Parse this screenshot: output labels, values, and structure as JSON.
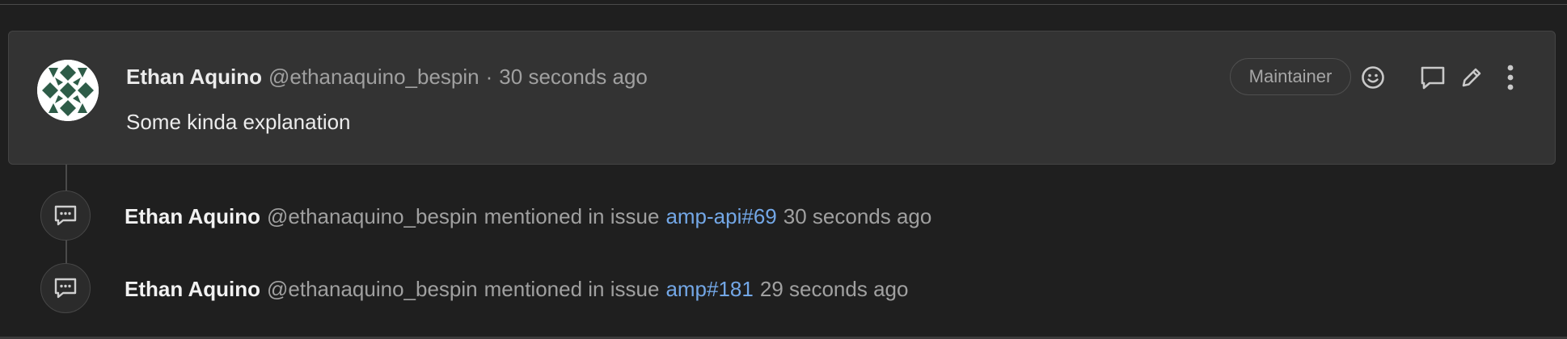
{
  "note": {
    "author_name": "Ethan Aquino",
    "author_handle": "@ethanaquino_bespin",
    "separator": "·",
    "timestamp": "30 seconds ago",
    "body": "Some kinda explanation",
    "role_badge": "Maintainer",
    "actions": [
      "add-reaction",
      "reply",
      "edit",
      "more-actions"
    ]
  },
  "system_notes": [
    {
      "author_name": "Ethan Aquino",
      "author_handle": "@ethanaquino_bespin",
      "action": "mentioned in issue",
      "reference": "amp-api#69",
      "timestamp": "30 seconds ago"
    },
    {
      "author_name": "Ethan Aquino",
      "author_handle": "@ethanaquino_bespin",
      "action": "mentioned in issue",
      "reference": "amp#181",
      "timestamp": "29 seconds ago"
    }
  ],
  "colors": {
    "background": "#1f1f1f",
    "card": "#333333",
    "link": "#73a7e6",
    "muted_text": "#a0a0a0",
    "avatar_pattern": "#2e5c48"
  }
}
